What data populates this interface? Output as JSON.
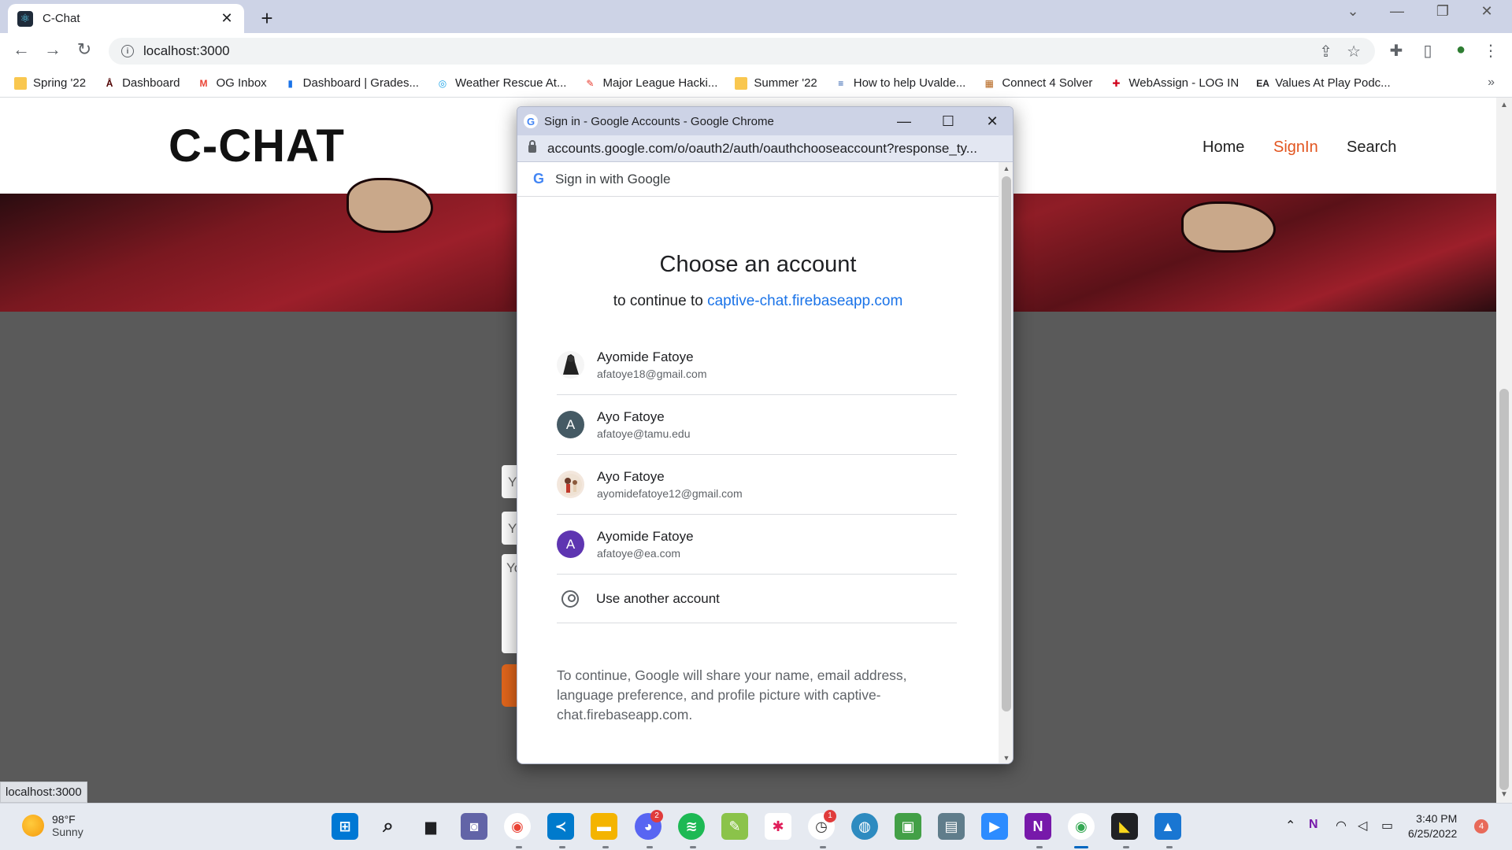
{
  "browser": {
    "tab_title": "C-Chat",
    "tab_close": "✕",
    "new_tab": "+",
    "url": "localhost:3000",
    "bookmarks": [
      {
        "label": "Spring '22",
        "icon": "folder-icon",
        "color": "#f9c74f"
      },
      {
        "label": "Dashboard",
        "icon": "tamu-icon",
        "color": "#500000"
      },
      {
        "label": "OG Inbox",
        "icon": "gmail-icon",
        "color": "#ea4335"
      },
      {
        "label": "Dashboard | Grades...",
        "icon": "chart-icon",
        "color": "#1a73e8"
      },
      {
        "label": "Weather Rescue At...",
        "icon": "weather-icon",
        "color": "#1aa3e8"
      },
      {
        "label": "Major League Hacki...",
        "icon": "mlh-icon",
        "color": "#e73427"
      },
      {
        "label": "Summer '22",
        "icon": "folder-icon",
        "color": "#f9c74f"
      },
      {
        "label": "How to help Uvalde...",
        "icon": "news-icon",
        "color": "#2255aa"
      },
      {
        "label": "Connect 4 Solver",
        "icon": "game-icon",
        "color": "#b5651d"
      },
      {
        "label": "WebAssign - LOG IN",
        "icon": "webassign-icon",
        "color": "#d0021b"
      },
      {
        "label": "Values At Play Podc...",
        "icon": "ea-icon",
        "color": "#202124"
      }
    ],
    "status_tip": "localhost:3000"
  },
  "site": {
    "logo": "C-CHAT",
    "nav": [
      {
        "label": "Home"
      },
      {
        "label": "SignIn"
      },
      {
        "label": "Search"
      }
    ],
    "form_fragments": [
      "Y",
      "Y",
      "Yo"
    ]
  },
  "popup": {
    "window_title": "Sign in - Google Accounts - Google Chrome",
    "url": "accounts.google.com/o/oauth2/auth/oauthchooseaccount?response_ty...",
    "sign_in_with": "Sign in with Google",
    "heading": "Choose an account",
    "continue_prefix": "to continue to",
    "continue_link": "captive-chat.firebaseapp.com",
    "accounts": [
      {
        "name": "Ayomide Fatoye",
        "email": "afatoye18@gmail.com",
        "avatar": "photo-avatar"
      },
      {
        "name": "Ayo Fatoye",
        "email": "afatoye@tamu.edu",
        "avatar": "A",
        "color": "#455a64"
      },
      {
        "name": "Ayo Fatoye",
        "email": "ayomidefatoye12@gmail.com",
        "avatar": "photo-avatar"
      },
      {
        "name": "Ayomide Fatoye",
        "email": "afatoye@ea.com",
        "avatar": "A",
        "color": "#5e35b1"
      }
    ],
    "use_another": "Use another account",
    "disclaimer": "To continue, Google will share your name, email address, language preference, and profile picture with captive-chat.firebaseapp.com."
  },
  "taskbar": {
    "weather_temp": "98°F",
    "weather_cond": "Sunny",
    "time": "3:40 PM",
    "date": "6/25/2022",
    "notifications": "4",
    "discord_badge": "2",
    "app_badge": "1"
  }
}
